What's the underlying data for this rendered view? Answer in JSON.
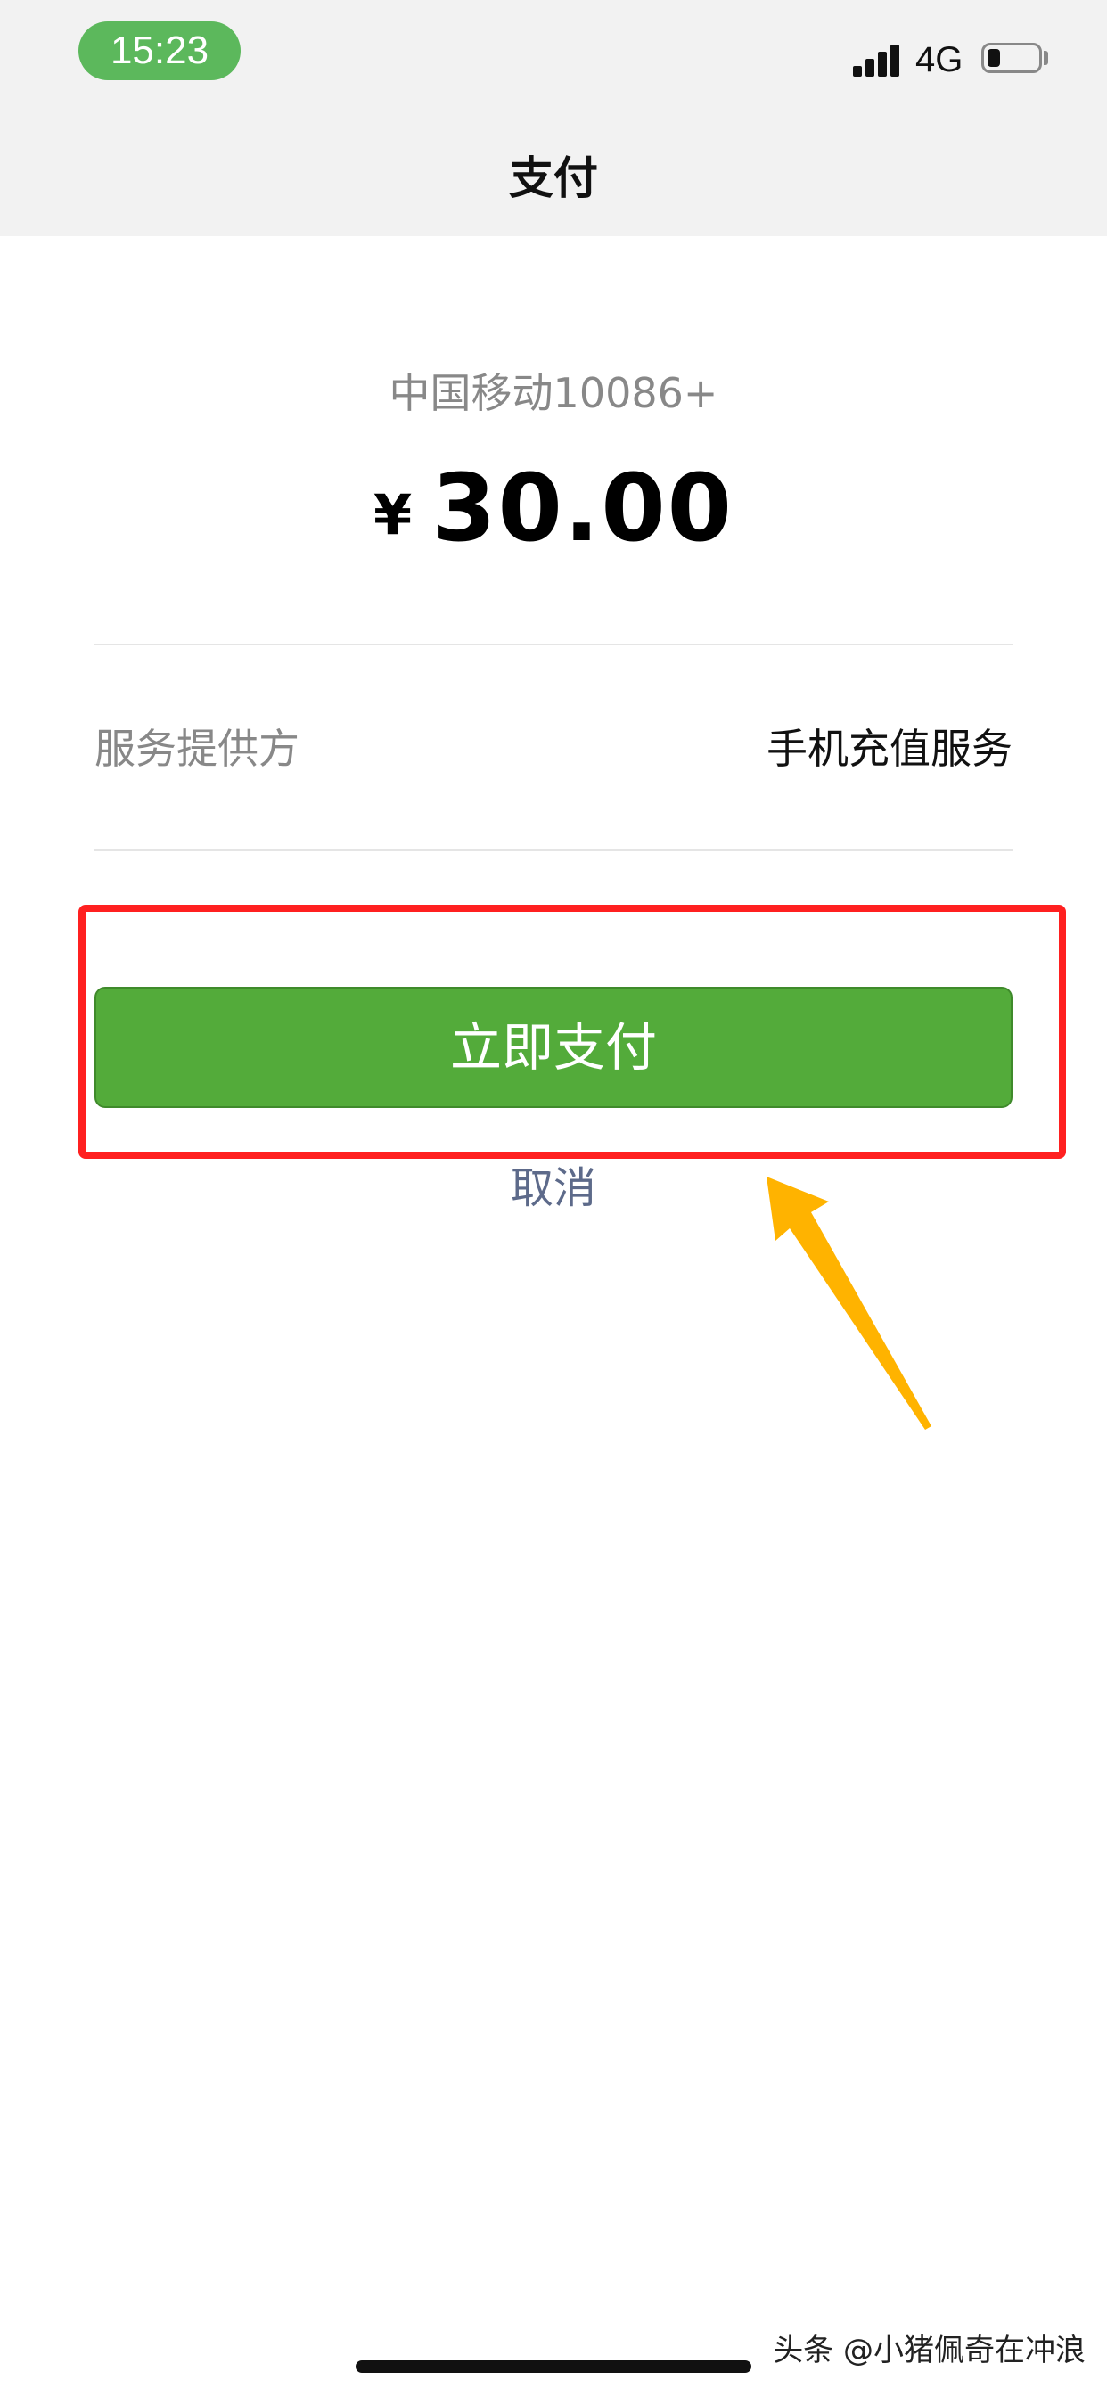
{
  "status_bar": {
    "time": "15:23",
    "network": "4G",
    "battery_level": 0.25
  },
  "nav": {
    "title": "支付"
  },
  "payment": {
    "merchant": "中国移动10086+",
    "currency": "¥",
    "amount": "30.00",
    "provider_label": "服务提供方",
    "provider_value": "手机充值服务"
  },
  "actions": {
    "pay_label": "立即支付",
    "cancel_label": "取消"
  },
  "annotation": {
    "highlight_color": "#ff2020",
    "arrow_color": "#ffb300"
  },
  "watermark": "头条 @小猪佩奇在冲浪",
  "colors": {
    "pay_button": "#53ab3a",
    "time_pill": "#5cb85c",
    "cancel_link": "#5d6a8a"
  }
}
